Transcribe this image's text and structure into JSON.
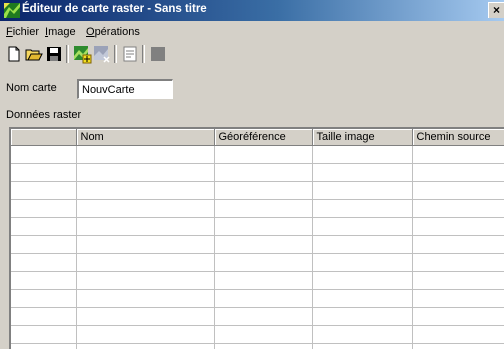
{
  "window": {
    "title": "Éditeur de carte raster - Sans titre",
    "close_label": "×",
    "title_bar_color": "#0a246a"
  },
  "menu": [
    {
      "label": "Fichier",
      "mnemonic": "F",
      "rest": "ichier"
    },
    {
      "label": "Image",
      "mnemonic": "I",
      "rest": "mage"
    },
    {
      "label": "Opérations",
      "mnemonic": "O",
      "rest": "pérations"
    }
  ],
  "toolbar": {
    "buttons": [
      "new-icon",
      "open-icon",
      "save-icon",
      "add-image-icon",
      "remove-image-icon",
      "properties-icon",
      "stop-icon"
    ]
  },
  "form": {
    "name_label": "Nom carte",
    "name_value": "NouvCarte"
  },
  "raster": {
    "section_label": "Données raster",
    "columns": [
      "",
      "Nom",
      "Géoréférence",
      "Taille image",
      "Chemin source"
    ],
    "rows": [
      [
        "",
        "",
        "",
        "",
        ""
      ],
      [
        "",
        "",
        "",
        "",
        ""
      ],
      [
        "",
        "",
        "",
        "",
        ""
      ],
      [
        "",
        "",
        "",
        "",
        ""
      ],
      [
        "",
        "",
        "",
        "",
        ""
      ],
      [
        "",
        "",
        "",
        "",
        ""
      ],
      [
        "",
        "",
        "",
        "",
        ""
      ],
      [
        "",
        "",
        "",
        "",
        ""
      ],
      [
        "",
        "",
        "",
        "",
        ""
      ],
      [
        "",
        "",
        "",
        "",
        ""
      ],
      [
        "",
        "",
        "",
        "",
        ""
      ],
      [
        "",
        "",
        "",
        "",
        ""
      ]
    ]
  }
}
